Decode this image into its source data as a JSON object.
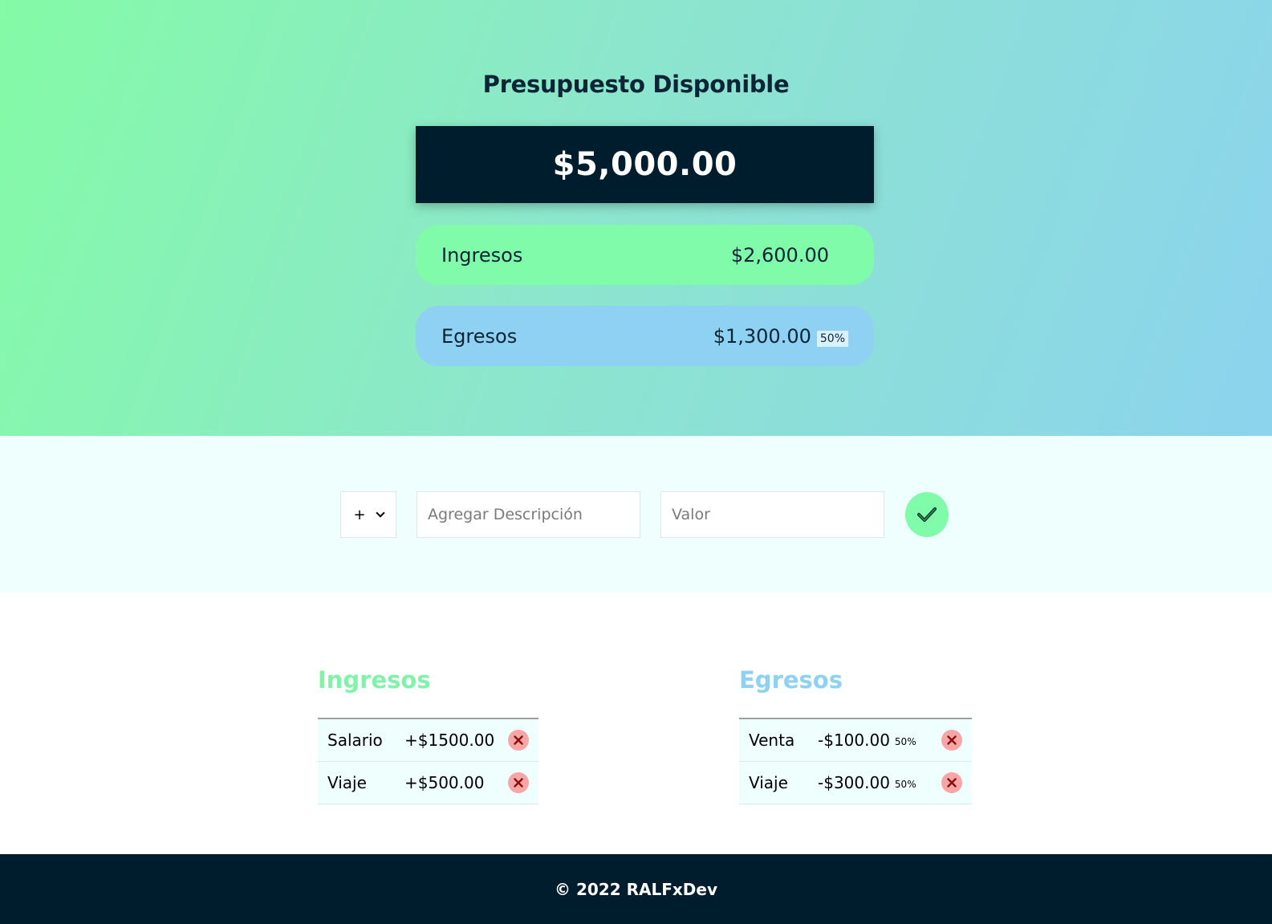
{
  "header": {
    "title": "Presupuesto Disponible",
    "total": "$5,000.00",
    "income": {
      "label": "Ingresos",
      "value": "$2,600.00"
    },
    "expense": {
      "label": "Egresos",
      "value": "$1,300.00",
      "percent": "50%"
    }
  },
  "form": {
    "type_value": "+",
    "description_placeholder": "Agregar Descripción",
    "value_placeholder": "Valor",
    "submit_icon": "check-icon"
  },
  "incomes": {
    "title": "Ingresos",
    "items": [
      {
        "description": "Salario",
        "value": "+$1500.00"
      },
      {
        "description": "Viaje",
        "value": "+$500.00"
      }
    ]
  },
  "expenses": {
    "title": "Egresos",
    "items": [
      {
        "description": "Venta",
        "value": "-$100.00",
        "percent": "50%"
      },
      {
        "description": "Viaje",
        "value": "-$300.00",
        "percent": "50%"
      }
    ]
  },
  "footer": {
    "text": "© 2022 RALFxDev"
  },
  "colors": {
    "dark": "#001d2e",
    "income": "#80fba9",
    "expense": "#8ed1f3",
    "delete": "#f6a6a6"
  }
}
